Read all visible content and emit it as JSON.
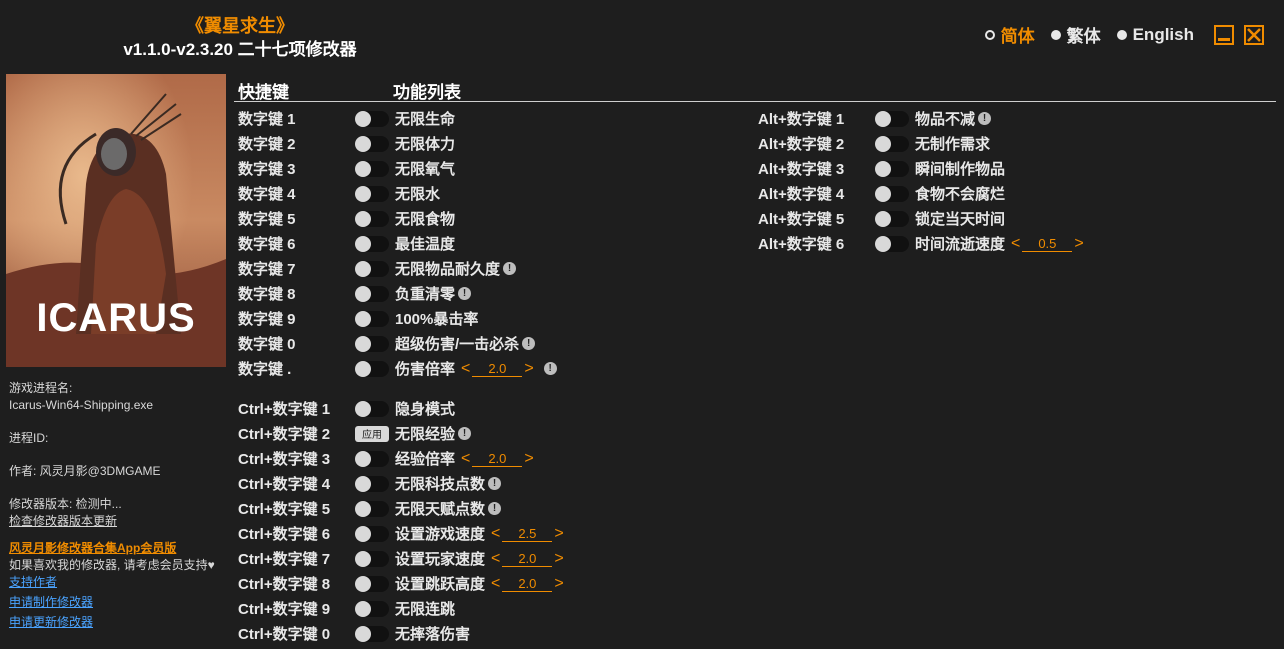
{
  "header": {
    "title": "《翼星求生》",
    "subtitle": "v1.1.0-v2.3.20 二十七项修改器"
  },
  "languages": [
    {
      "label": "简体",
      "active": true
    },
    {
      "label": "繁体",
      "active": false
    },
    {
      "label": "English",
      "active": false
    }
  ],
  "cover": {
    "logo_text": "ICARUS"
  },
  "info": {
    "process_label": "游戏进程名:",
    "process_value": "Icarus-Win64-Shipping.exe",
    "pid_label": "进程ID:",
    "author": "作者: 风灵月影@3DMGAME",
    "version_status": "修改器版本: 检测中...",
    "check_update": "检查修改器版本更新",
    "promo": "风灵月影修改器合集App会员版",
    "support_text": "如果喜欢我的修改器, 请考虑会员支持",
    "heart": "♥",
    "support_author": "支持作者",
    "request_trainer": "申请制作修改器",
    "request_update": "申请更新修改器"
  },
  "columns": {
    "hotkey": "快捷键",
    "features": "功能列表"
  },
  "left_features": [
    {
      "key": "数字键 1",
      "label": "无限生命"
    },
    {
      "key": "数字键 2",
      "label": "无限体力"
    },
    {
      "key": "数字键 3",
      "label": "无限氧气"
    },
    {
      "key": "数字键 4",
      "label": "无限水"
    },
    {
      "key": "数字键 5",
      "label": "无限食物"
    },
    {
      "key": "数字键 6",
      "label": "最佳温度"
    },
    {
      "key": "数字键 7",
      "label": "无限物品耐久度",
      "warn": "!"
    },
    {
      "key": "数字键 8",
      "label": "负重清零",
      "warn": "!"
    },
    {
      "key": "数字键 9",
      "label": "100%暴击率"
    },
    {
      "key": "数字键 0",
      "label": "超级伤害/一击必杀",
      "warn": "!"
    },
    {
      "key": "数字键 .",
      "label": "伤害倍率",
      "value": "2.0",
      "warn": "!"
    },
    {
      "key": "Ctrl+数字键 1",
      "label": "隐身模式"
    },
    {
      "key": "Ctrl+数字键 2",
      "label": "无限经验",
      "button": "应用",
      "warn": "!"
    },
    {
      "key": "Ctrl+数字键 3",
      "label": "经验倍率",
      "value": "2.0"
    },
    {
      "key": "Ctrl+数字键 4",
      "label": "无限科技点数",
      "warn": "!"
    },
    {
      "key": "Ctrl+数字键 5",
      "label": "无限天赋点数",
      "warn": "!"
    },
    {
      "key": "Ctrl+数字键 6",
      "label": "设置游戏速度",
      "value": "2.5"
    },
    {
      "key": "Ctrl+数字键 7",
      "label": "设置玩家速度",
      "value": "2.0"
    },
    {
      "key": "Ctrl+数字键 8",
      "label": "设置跳跃高度",
      "value": "2.0"
    },
    {
      "key": "Ctrl+数字键 9",
      "label": "无限连跳"
    },
    {
      "key": "Ctrl+数字键 0",
      "label": "无摔落伤害"
    }
  ],
  "right_features": [
    {
      "key": "Alt+数字键 1",
      "label": "物品不减",
      "warn": "!"
    },
    {
      "key": "Alt+数字键 2",
      "label": "无制作需求"
    },
    {
      "key": "Alt+数字键 3",
      "label": "瞬间制作物品"
    },
    {
      "key": "Alt+数字键 4",
      "label": "食物不会腐烂"
    },
    {
      "key": "Alt+数字键 5",
      "label": "锁定当天时间"
    },
    {
      "key": "Alt+数字键 6",
      "label": "时间流逝速度",
      "value": "0.5"
    }
  ],
  "stepper_arrows": {
    "left": "<",
    "right": ">"
  },
  "colors": {
    "accent": "#f08c00",
    "background": "#1e1e1e",
    "link": "#4aa3ff"
  }
}
